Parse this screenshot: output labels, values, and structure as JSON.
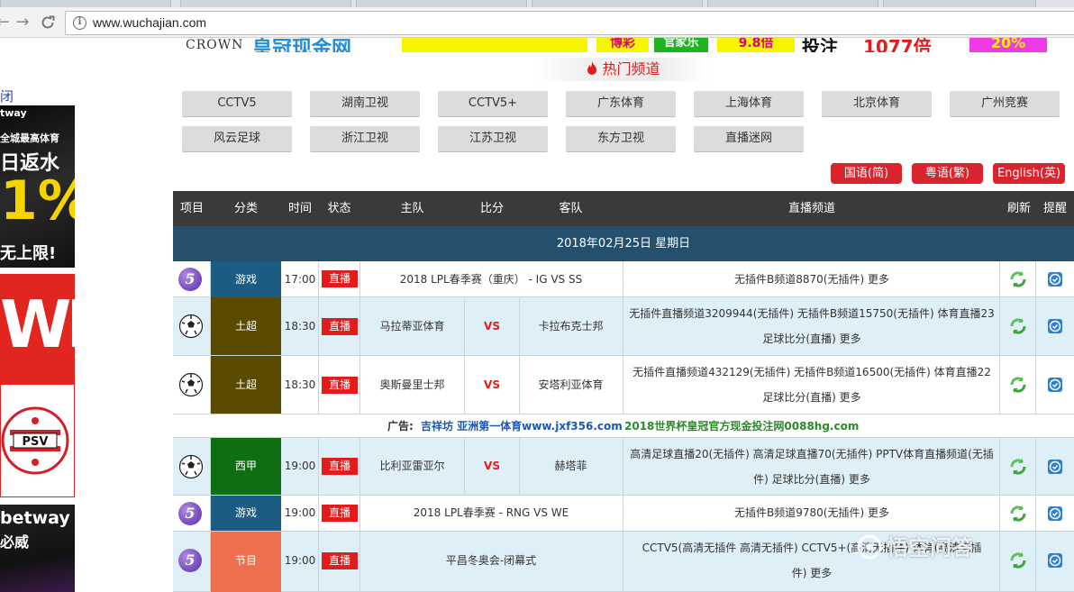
{
  "browser": {
    "url": "www.wuchajian.com"
  },
  "banner": {
    "crown": "CROWN",
    "b1": "皇冠现金网",
    "b3": "博彩",
    "b4": "官家乐",
    "b5": "9.8倍",
    "b6": "投注",
    "b7": "1077倍",
    "b8": "20%"
  },
  "hot_title": "热门频道",
  "left_ads": {
    "close": "闭",
    "ad1_line1": "tway",
    "ad1_line2": "全城最高体育",
    "ad1_line3": "日返水",
    "ad1_line4": "1%",
    "ad1_line5": "无上限!",
    "ad2_text": "WB",
    "ad4_line1": "betway",
    "ad4_line2": "必威"
  },
  "channels_row1": [
    "CCTV5",
    "湖南卫视",
    "CCTV5+",
    "广东体育",
    "上海体育",
    "北京体育",
    "广州竞赛"
  ],
  "channels_row2": [
    "风云足球",
    "浙江卫视",
    "江苏卫视",
    "东方卫视",
    "直播迷网"
  ],
  "languages": [
    "国语(简)",
    "粤语(繁)",
    "English(英)"
  ],
  "table": {
    "headers": [
      "项目",
      "分类",
      "时间",
      "状态",
      "主队",
      "比分",
      "客队",
      "直播频道",
      "刷新",
      "提醒"
    ],
    "date": "2018年02月25日  星期日",
    "live_label": "直播",
    "vs_label": "VS",
    "rows": [
      {
        "category": "游戏",
        "time": "17:00",
        "title": "2018 LPL春季赛（重庆） - IG VS SS",
        "channels": [
          "无插件B频道8870(无插件)  更多"
        ]
      },
      {
        "category": "土超",
        "time": "18:30",
        "home": "马拉蒂亚体育",
        "away": "卡拉布克士邦",
        "channels": [
          "无插件直播频道3209944(无插件)  无插件B频道15750(无插件)  体育直播23",
          "足球比分(直播)  更多"
        ]
      },
      {
        "category": "土超",
        "time": "18:30",
        "home": "奥斯曼里士邦",
        "away": "安塔利亚体育",
        "channels": [
          "无插件直播频道432129(无插件)  无插件B频道16500(无插件)  体育直播22",
          "足球比分(直播)  更多"
        ]
      },
      {
        "category": "西甲",
        "time": "19:00",
        "home": "比利亚雷亚尔",
        "away": "赫塔菲",
        "channels": [
          "高清足球直播20(无插件)   高清足球直播70(无插件)   PPTV体育直播频道(无插",
          "件)  足球比分(直播)  更多"
        ]
      },
      {
        "category": "游戏",
        "time": "19:00",
        "title": "2018 LPL春季赛 - RNG VS WE",
        "channels": [
          "无插件B频道9780(无插件)  更多"
        ]
      },
      {
        "category": "节目",
        "time": "19:00",
        "title": "平昌冬奥会-闭幕式",
        "channels": [
          "CCTV5(高清无插件   高清无插件)   CCTV5+(高清无插件)   体育(高清无插",
          "件)  更多"
        ]
      }
    ],
    "ad": {
      "label": "广告:",
      "link1": "吉祥坊 亚洲第一体育www.jxf356.com",
      "link2": "2018世界杯皇冠官方现金投注网0088hg.com"
    }
  },
  "watermark": "悟空问答",
  "colors": {
    "header_bg": "#3a3a3a",
    "date_band": "#24506d",
    "live_red": "#e21b1b",
    "cat_game": "#1b5c82",
    "cat_turkey": "#5a4a00",
    "cat_laliga": "#0f6e12",
    "cat_show": "#ee6f4e"
  }
}
